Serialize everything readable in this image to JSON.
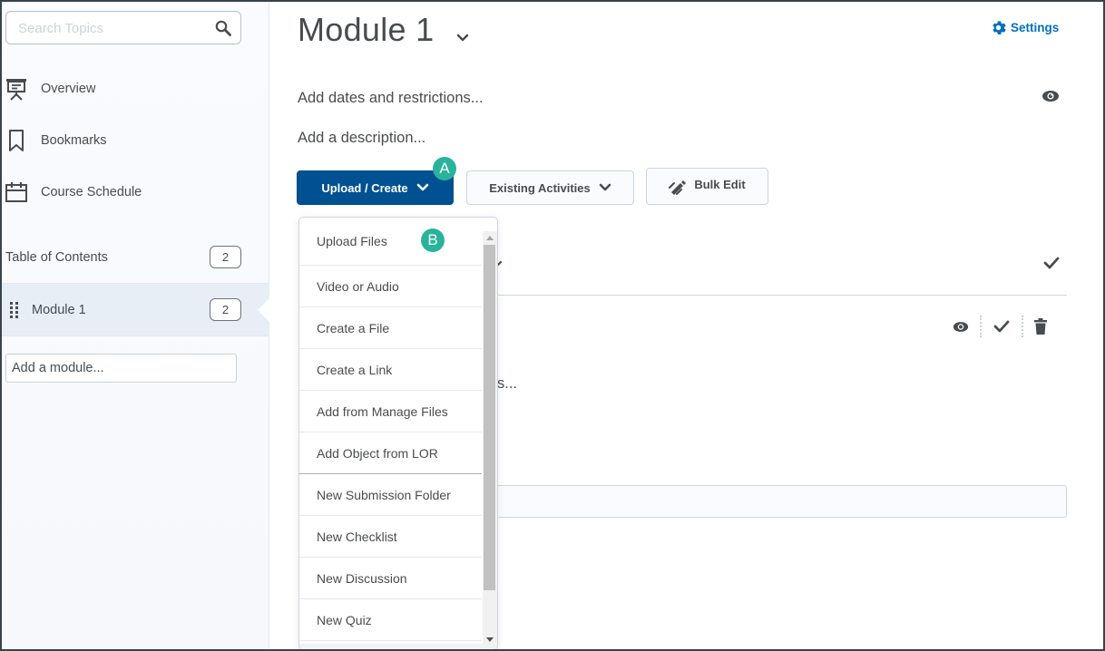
{
  "sidebar": {
    "search": {
      "placeholder": "Search Topics",
      "value": ""
    },
    "nav_items": [
      {
        "label": "Overview",
        "icon": "presentation-board-icon"
      },
      {
        "label": "Bookmarks",
        "icon": "bookmark-icon"
      },
      {
        "label": "Course Schedule",
        "icon": "calendar-icon"
      }
    ],
    "table_of_contents": {
      "label": "Table of Contents",
      "count": "2"
    },
    "modules": [
      {
        "label": "Module 1",
        "count": "2",
        "selected": true
      }
    ],
    "add_module": {
      "placeholder": "Add a module...",
      "value": ""
    }
  },
  "main": {
    "title": "Module 1",
    "settings_label": "Settings",
    "dates_link": "Add dates and restrictions...",
    "description_link": "Add a description...",
    "toolbar": {
      "upload_create_label": "Upload / Create",
      "existing_activities_label": "Existing Activities",
      "bulk_edit_label": "Bulk Edit"
    },
    "partial_text": "s...",
    "callouts": {
      "a": "A",
      "b": "B"
    }
  },
  "dropdown": {
    "items": [
      {
        "label": "Upload Files"
      },
      {
        "label": "Video or Audio"
      },
      {
        "label": "Create a File"
      },
      {
        "label": "Create a Link"
      },
      {
        "label": "Add from Manage Files"
      },
      {
        "label": "Add Object from LOR"
      },
      {
        "label": "New Submission Folder"
      },
      {
        "label": "New Checklist"
      },
      {
        "label": "New Discussion"
      },
      {
        "label": "New Quiz"
      }
    ]
  },
  "colors": {
    "primary": "#005192",
    "link": "#006fbf",
    "callout": "#29b39b",
    "text": "#494c4e",
    "frame": "#38434d"
  }
}
